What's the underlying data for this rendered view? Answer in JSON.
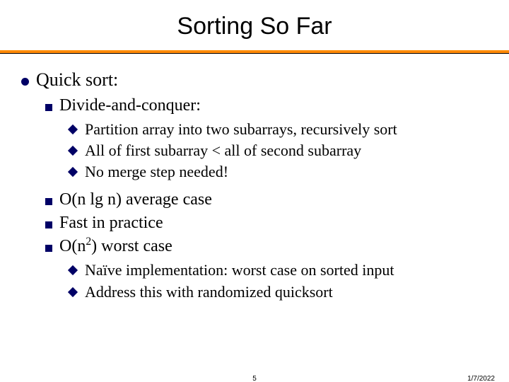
{
  "title": "Sorting So Far",
  "level1_1": "Quick sort:",
  "level2_1": "Divide-and-conquer:",
  "level3_1": "Partition array into two subarrays, recursively sort",
  "level3_2": "All of first subarray < all of second subarray",
  "level3_3": "No merge step needed!",
  "level2_2": "O(n lg n) average case",
  "level2_3": "Fast in practice",
  "level2_4a": "O(n",
  "level2_4_sup": "2",
  "level2_4b": ") worst case",
  "level3_4": "Naïve implementation: worst case on sorted input",
  "level3_5": "Address this with randomized quicksort",
  "page": "5",
  "date": "1/7/2022"
}
